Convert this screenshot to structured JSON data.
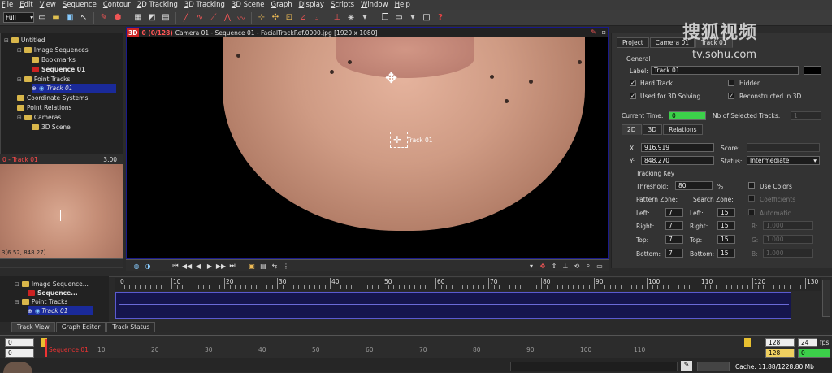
{
  "menu": [
    "File",
    "Edit",
    "View",
    "Sequence",
    "Contour",
    "2D Tracking",
    "3D Tracking",
    "3D Scene",
    "Graph",
    "Display",
    "Scripts",
    "Window",
    "Help"
  ],
  "toolbar": {
    "display_mode": "Full"
  },
  "tree": {
    "root": "Untitled",
    "items": [
      {
        "label": "Image Sequences",
        "type": "folder"
      },
      {
        "label": "Bookmarks",
        "type": "folder"
      },
      {
        "label": "Sequence 01",
        "type": "sequence"
      },
      {
        "label": "Point Tracks",
        "type": "folder"
      },
      {
        "label": "Track 01",
        "type": "track"
      },
      {
        "label": "Coordinate Systems",
        "type": "folder"
      },
      {
        "label": "Point Relations",
        "type": "folder"
      },
      {
        "label": "Cameras",
        "type": "folder"
      },
      {
        "label": "3D Scene",
        "type": "folder"
      }
    ]
  },
  "preview": {
    "title": "0 - Track 01",
    "zoom": "3.00",
    "coords": "3(6.52, 848.27)"
  },
  "viewport": {
    "badge": "3D",
    "frame_counter": "0 (0/128)",
    "title": "Camera 01 - Sequence 01 - FacialTrackRef.0000.jpg [1920 x 1080]",
    "track_label": "Track 01"
  },
  "right_panel": {
    "tabs": [
      "Project",
      "Camera 01",
      "Track 01"
    ],
    "general_label": "General",
    "label_caption": "Label:",
    "label_value": "Track 01",
    "hard_track": "Hard Track",
    "hidden": "Hidden",
    "used_for_3d": "Used for 3D Solving",
    "reconstructed": "Reconstructed in 3D",
    "current_time_caption": "Current Time:",
    "current_time_value": "0",
    "nb_selected_caption": "Nb of Selected Tracks:",
    "nb_selected_value": "1",
    "sub_tabs": [
      "2D",
      "3D",
      "Relations"
    ],
    "x_caption": "X:",
    "x_value": "916.919",
    "y_caption": "Y:",
    "y_value": "848.270",
    "score_caption": "Score:",
    "status_caption": "Status:",
    "status_value": "Intermediate",
    "tracking_key": "Tracking Key",
    "threshold_caption": "Threshold:",
    "threshold_value": "80",
    "threshold_unit": "%",
    "use_colors": "Use Colors",
    "pattern_zone": "Pattern Zone:",
    "search_zone": "Search Zone:",
    "coefficients": "Coefficients",
    "automatic": "Automatic",
    "left": "Left:",
    "right": "Right:",
    "top": "Top:",
    "bottom": "Bottom:",
    "pattern": {
      "left": "7",
      "right": "7",
      "top": "7",
      "bottom": "7"
    },
    "search": {
      "left": "15",
      "right": "15",
      "top": "15",
      "bottom": "15"
    },
    "r": "R:",
    "g": "G:",
    "b": "B:",
    "r_value": "1.000",
    "g_value": "1.000",
    "b_value": "1.000"
  },
  "timeline": {
    "tree_items": [
      "Image Sequence...",
      "Sequence...",
      "Point Tracks",
      "Track 01"
    ],
    "ruler": [
      "0",
      "10",
      "20",
      "30",
      "40",
      "50",
      "60",
      "70",
      "80",
      "90",
      "100",
      "110",
      "120",
      "130"
    ]
  },
  "bottom_tabs": [
    "Track View",
    "Graph Editor",
    "Track Status"
  ],
  "bottom_ruler": {
    "start_top": "0",
    "start_bottom": "0",
    "sequence_label": "Sequence 01",
    "ticks": [
      "10",
      "20",
      "30",
      "40",
      "50",
      "60",
      "70",
      "80",
      "90",
      "100",
      "110"
    ],
    "end_frame": "128",
    "end_frame2": "128",
    "fps": "24",
    "fps_label": "fps",
    "range_value": "0"
  },
  "status": {
    "cache": "Cache: 11.88/1228.80 Mb"
  },
  "watermark": {
    "line1": "搜狐视频",
    "line2": "tv.sohu.com"
  }
}
